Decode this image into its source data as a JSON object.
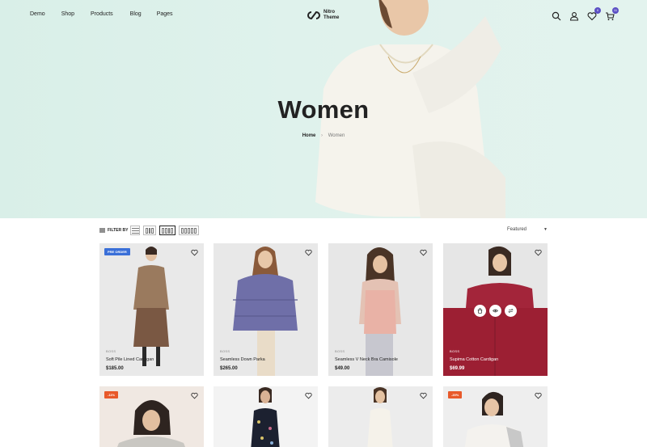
{
  "nav": {
    "items": [
      {
        "label": "Demo"
      },
      {
        "label": "Shop"
      },
      {
        "label": "Products"
      },
      {
        "label": "Blog"
      },
      {
        "label": "Pages"
      }
    ]
  },
  "logo": {
    "line1": "Nitro",
    "line2": "Theme"
  },
  "header": {
    "icons": [
      "search-icon",
      "user-icon",
      "heart-icon",
      "cart-icon"
    ],
    "wishlist_count": "0",
    "cart_count": "11"
  },
  "hero": {
    "title": "Women",
    "breadcrumb": {
      "home": "Home",
      "current": "Women"
    }
  },
  "toolbar": {
    "filter_label": "FILTER BY",
    "sort_value": "Featured",
    "views": [
      "list",
      "grid-2",
      "grid-3",
      "grid-4"
    ]
  },
  "products": [
    {
      "tag": "PRE ORDER",
      "tag_color": "#3a6fd8",
      "brand": "BOSS",
      "name": "Soft Pile Lined Cardigan",
      "price": "$185.00"
    },
    {
      "tag": "",
      "brand": "BOSS",
      "name": "Seamless Down Parka",
      "price": "$265.00"
    },
    {
      "tag": "",
      "brand": "BOSS",
      "name": "Seamless V Neck Bra Camisole",
      "price": "$49.00"
    },
    {
      "tag": "",
      "brand": "BOSS",
      "name": "Supima Cotton Cardigan",
      "price": "$69.99"
    },
    {
      "tag": "-11%",
      "tag_color": "#e8592a"
    },
    {
      "tag": ""
    },
    {
      "tag": ""
    },
    {
      "tag": "-20%",
      "tag_color": "#e8592a"
    }
  ],
  "colors": {
    "hero_bg": "#dcf0ea",
    "badge": "#5b4fc4",
    "sale": "#e8592a",
    "preorder": "#3a6fd8"
  }
}
